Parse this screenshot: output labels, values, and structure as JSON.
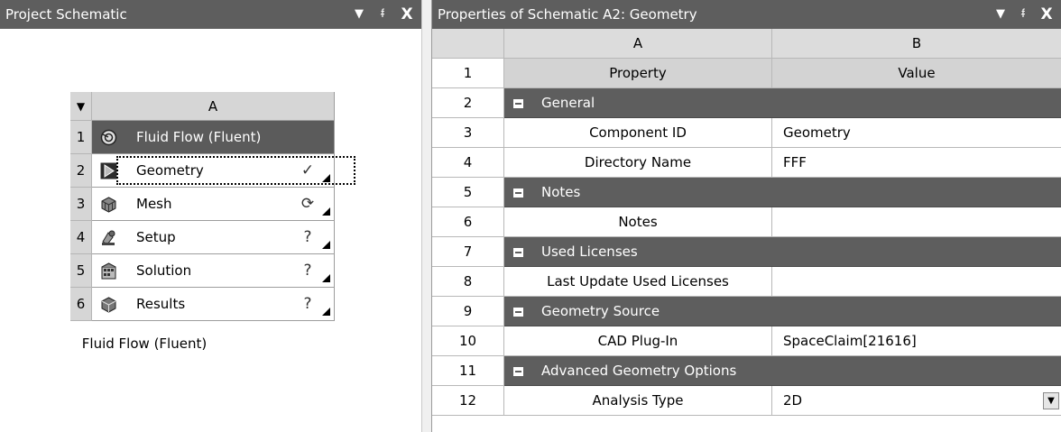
{
  "left_panel": {
    "title": "Project Schematic",
    "controls": {
      "dropdown": "▼",
      "pin": "ᵮ",
      "close": "X"
    },
    "system": {
      "menu_arrow": "▼",
      "column": "A",
      "rows": [
        {
          "num": "1",
          "label": "Fluid Flow (Fluent)",
          "icon": "fluid-flow-icon",
          "status": ""
        },
        {
          "num": "2",
          "label": "Geometry",
          "icon": "geometry-icon",
          "status": "✓"
        },
        {
          "num": "3",
          "label": "Mesh",
          "icon": "mesh-icon",
          "status": "⟳"
        },
        {
          "num": "4",
          "label": "Setup",
          "icon": "setup-icon",
          "status": "?"
        },
        {
          "num": "5",
          "label": "Solution",
          "icon": "solution-icon",
          "status": "?"
        },
        {
          "num": "6",
          "label": "Results",
          "icon": "results-icon",
          "status": "?"
        }
      ],
      "caption": "Fluid Flow (Fluent)"
    }
  },
  "right_panel": {
    "title": "Properties of Schematic A2: Geometry",
    "controls": {
      "dropdown": "▼",
      "pin": "ᵮ",
      "close": "X"
    },
    "columns": {
      "a": "A",
      "b": "B"
    },
    "header_row": {
      "num": "1",
      "a": "Property",
      "b": "Value"
    },
    "rows": [
      {
        "num": "2",
        "type": "category",
        "label": "General"
      },
      {
        "num": "3",
        "type": "prop",
        "a": "Component ID",
        "b": "Geometry"
      },
      {
        "num": "4",
        "type": "prop",
        "a": "Directory Name",
        "b": "FFF"
      },
      {
        "num": "5",
        "type": "category",
        "label": "Notes"
      },
      {
        "num": "6",
        "type": "prop",
        "a": "Notes",
        "b": ""
      },
      {
        "num": "7",
        "type": "category",
        "label": "Used Licenses"
      },
      {
        "num": "8",
        "type": "prop",
        "a": "Last Update Used Licenses",
        "b": ""
      },
      {
        "num": "9",
        "type": "category",
        "label": "Geometry Source"
      },
      {
        "num": "10",
        "type": "prop",
        "a": "CAD Plug-In",
        "b": "SpaceClaim[21616]"
      },
      {
        "num": "11",
        "type": "category",
        "label": "Advanced Geometry Options"
      },
      {
        "num": "12",
        "type": "prop",
        "a": "Analysis Type",
        "b": "2D",
        "dropdown": true
      }
    ]
  },
  "colors": {
    "title_bar": "#5e5e5e",
    "category": "#5e5e5e",
    "header": "#dcdcdc"
  }
}
